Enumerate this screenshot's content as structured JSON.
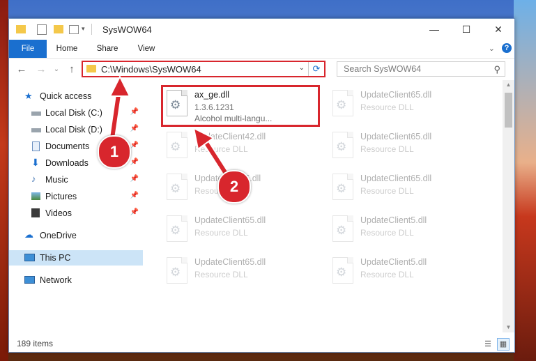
{
  "window": {
    "title": "SysWOW64",
    "controls": {
      "minimize": "—",
      "maximize": "☐",
      "close": "✕"
    }
  },
  "ribbon": {
    "tabs": [
      "File",
      "Home",
      "Share",
      "View"
    ],
    "help": "?",
    "collapse": "⌄"
  },
  "navigation": {
    "back": "←",
    "forward": "→",
    "recent": "⌄",
    "up": "↑",
    "address": "C:\\Windows\\SysWOW64",
    "dropdown": "⌄",
    "refresh": "⟳",
    "search_placeholder": "Search SysWOW64"
  },
  "sidebar": {
    "items": [
      {
        "label": "Quick access",
        "icon": "star-icon",
        "pinned": false
      },
      {
        "label": "Local Disk (C:)",
        "icon": "drive-icon",
        "pinned": true
      },
      {
        "label": "Local Disk (D:)",
        "icon": "drive-icon",
        "pinned": true
      },
      {
        "label": "Documents",
        "icon": "documents-icon",
        "pinned": true
      },
      {
        "label": "Downloads",
        "icon": "download-icon",
        "pinned": true
      },
      {
        "label": "Music",
        "icon": "music-icon",
        "pinned": true
      },
      {
        "label": "Pictures",
        "icon": "pictures-icon",
        "pinned": true
      },
      {
        "label": "Videos",
        "icon": "video-icon",
        "pinned": true
      },
      {
        "label": "OneDrive",
        "icon": "cloud-icon",
        "pinned": false
      },
      {
        "label": "This PC",
        "icon": "computer-icon",
        "pinned": false,
        "selected": true
      },
      {
        "label": "Network",
        "icon": "network-icon",
        "pinned": false
      }
    ]
  },
  "files": [
    {
      "name": "ax_ge.dll",
      "line2": "1.3.6.1231",
      "line3": "Alcohol multi-langu...",
      "highlighted": true
    },
    {
      "name": "UpdateClient65.dll",
      "line2": "Resource DLL"
    },
    {
      "name": "UpdateClient42.dll",
      "line2": "Resource DLL"
    },
    {
      "name": "UpdateClient65.dll",
      "line2": "Resource DLL"
    },
    {
      "name": "UpdateClient5.dll",
      "line2": "Resource DLL"
    },
    {
      "name": "UpdateClient65.dll",
      "line2": "Resource DLL"
    },
    {
      "name": "UpdateClient65.dll",
      "line2": "Resource DLL"
    },
    {
      "name": "UpdateClient5.dll",
      "line2": "Resource DLL"
    },
    {
      "name": "UpdateClient65.dll",
      "line2": "Resource DLL"
    },
    {
      "name": "UpdateClient5.dll",
      "line2": "Resource DLL"
    }
  ],
  "status": {
    "count": "189 items"
  },
  "annotations": {
    "step1": "1",
    "step2": "2"
  },
  "colors": {
    "accent": "#1a6fcf",
    "highlight": "#d8262d",
    "selected": "#cce4f7"
  }
}
